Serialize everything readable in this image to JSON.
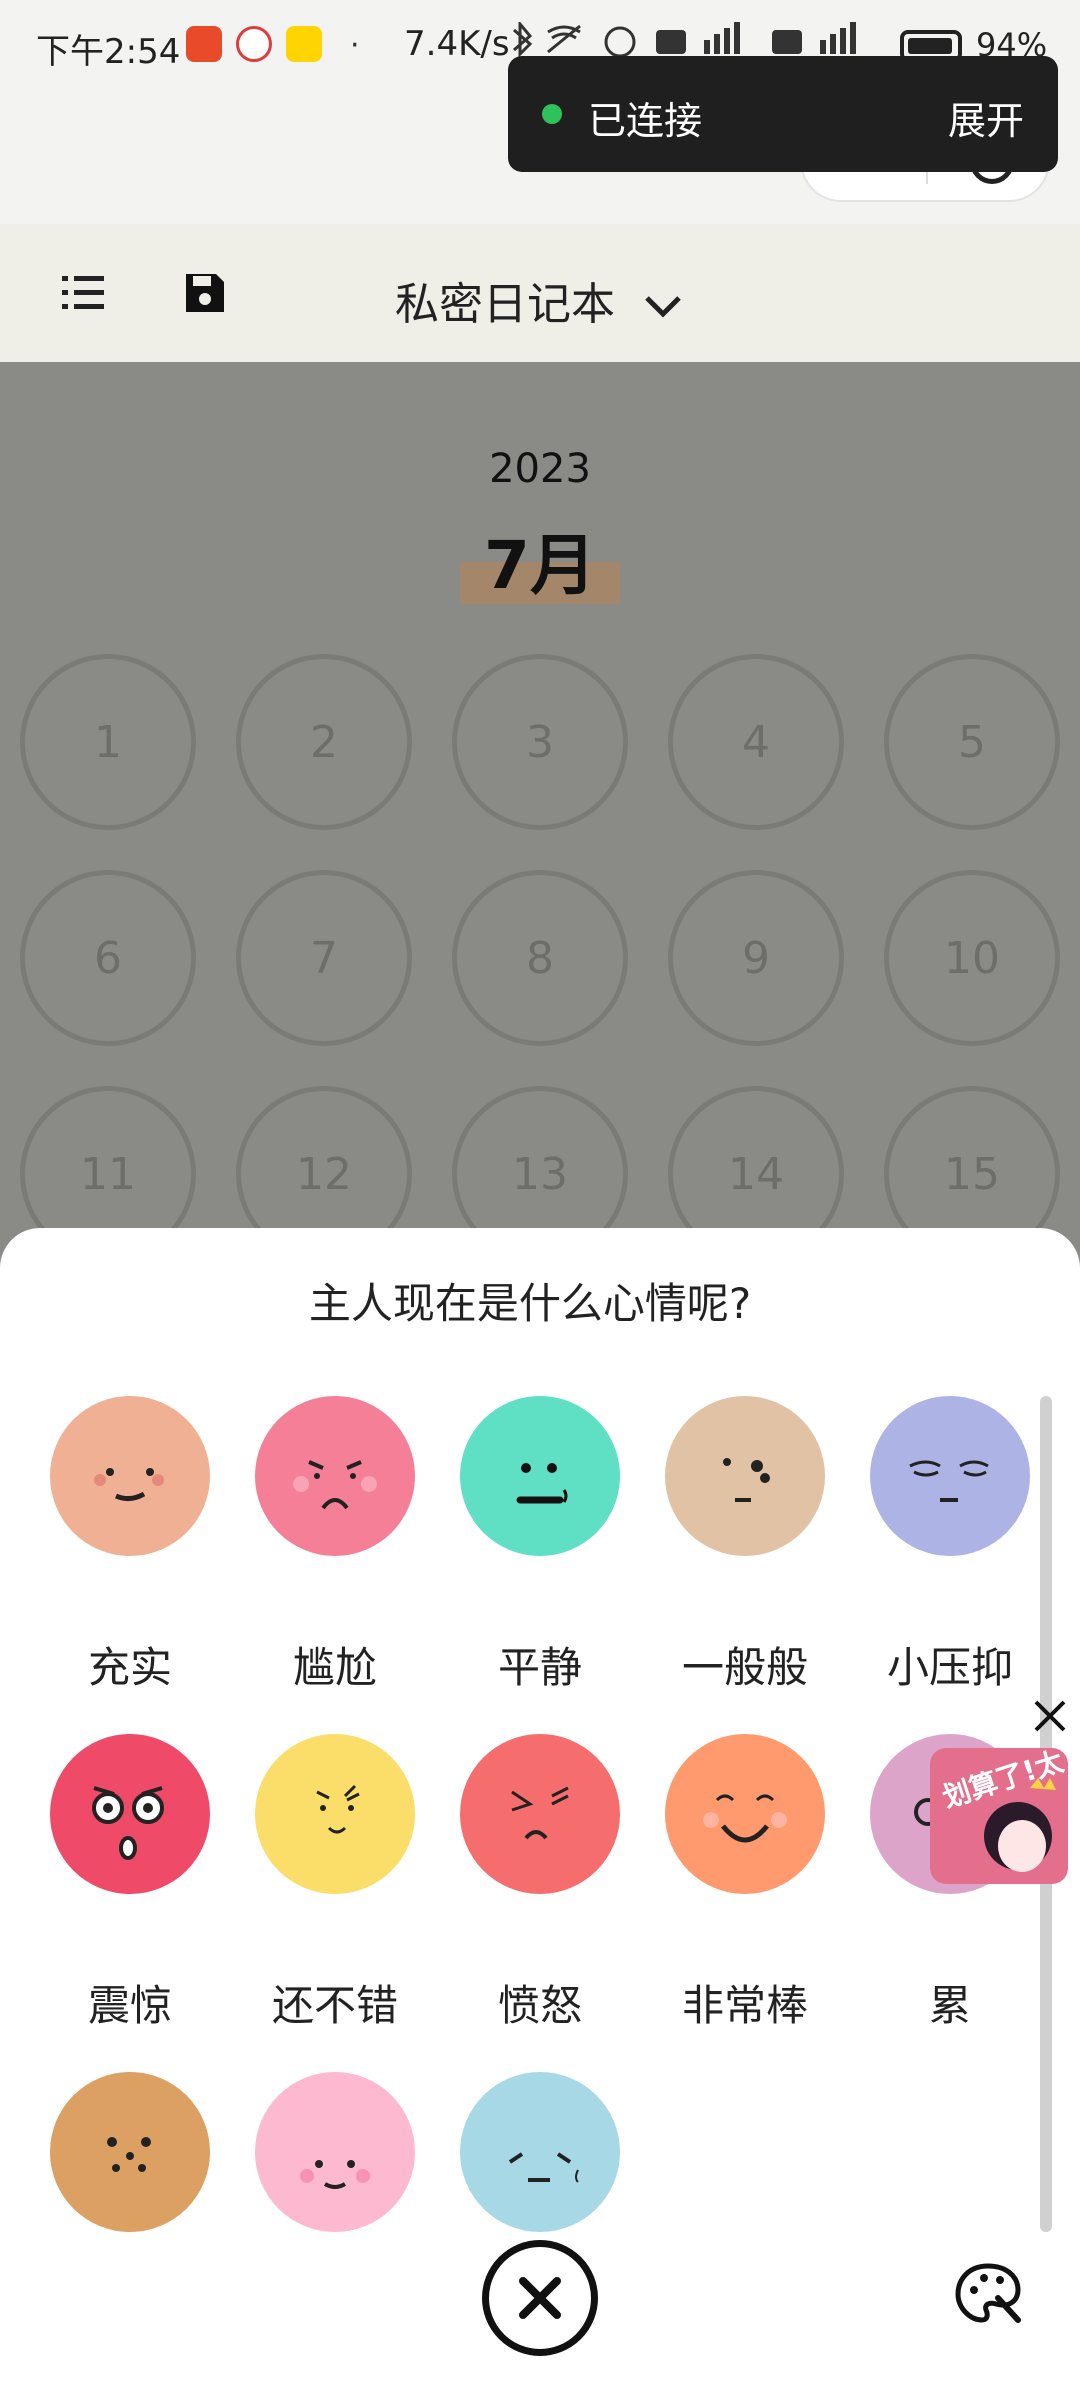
{
  "status_bar": {
    "time": "下午2:54",
    "speed": "7.4K/s",
    "network": "HD 4G HD 4G",
    "battery": "94%"
  },
  "toast": {
    "status": "已连接",
    "expand": "展开",
    "status_color": "#2fc25b"
  },
  "capsule": {
    "more": "•••"
  },
  "toolbar": {
    "title": "私密日记本",
    "menu_icon": "list-icon",
    "save_icon": "save-icon",
    "dropdown_icon": "chevron-down-icon"
  },
  "calendar": {
    "year": "2023",
    "month": "7月",
    "days": [
      "1",
      "2",
      "3",
      "4",
      "5",
      "6",
      "7",
      "8",
      "9",
      "10",
      "11",
      "12",
      "13",
      "14",
      "15"
    ]
  },
  "sheet": {
    "title": "主人现在是什么心情呢?",
    "moods": [
      {
        "label": "充实",
        "color": "#efb093",
        "icon": "content-face-icon"
      },
      {
        "label": "尴尬",
        "color": "#f47f96",
        "icon": "awkward-face-icon"
      },
      {
        "label": "平静",
        "color": "#5fdfc3",
        "icon": "calm-face-icon"
      },
      {
        "label": "一般般",
        "color": "#e2c2a4",
        "icon": "meh-face-icon"
      },
      {
        "label": "小压抑",
        "color": "#aeb3e6",
        "icon": "depressed-face-icon"
      },
      {
        "label": "震惊",
        "color": "#ef4a68",
        "icon": "shocked-face-icon"
      },
      {
        "label": "还不错",
        "color": "#fbdd6a",
        "icon": "not-bad-face-icon"
      },
      {
        "label": "愤怒",
        "color": "#f56d6d",
        "icon": "angry-face-icon"
      },
      {
        "label": "非常棒",
        "color": "#fe9a6d",
        "icon": "great-face-icon"
      },
      {
        "label": "累",
        "color": "#dda4c9",
        "icon": "tired-face-icon"
      },
      {
        "label": "",
        "color": "#dca063",
        "icon": "face-icon"
      },
      {
        "label": "",
        "color": "#fdb9cf",
        "icon": "face-icon"
      },
      {
        "label": "",
        "color": "#a7d8e5",
        "icon": "sad-face-icon"
      }
    ]
  },
  "ad": {
    "text": "划算了!太"
  }
}
